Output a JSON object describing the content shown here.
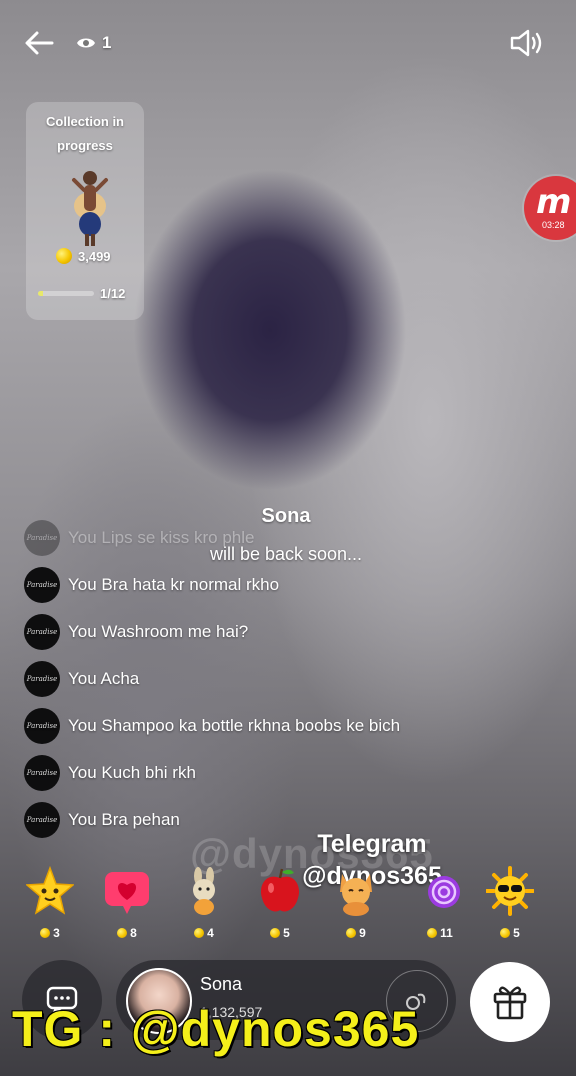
{
  "top_bar": {
    "back_icon": "arrow-left-icon",
    "viewer_icon": "eye-icon",
    "viewer_count": "1",
    "sound_icon": "speaker-icon"
  },
  "collection": {
    "title": "Collection in progress",
    "coin_value": "3,499",
    "progress_text": "1/12",
    "progress_fraction": 0.083
  },
  "recorder": {
    "logo": "m",
    "time": "03:28",
    "color": "#d9373e"
  },
  "host_message": {
    "name": "Sona",
    "status": "will be back soon..."
  },
  "chat": {
    "messages": [
      {
        "sender": "You",
        "text": "Lips se kiss kro phle",
        "avatar_text": "Paradise",
        "faded": true
      },
      {
        "sender": "You",
        "text": "Bra hata kr normal rkho",
        "avatar_text": "Paradise",
        "faded": false
      },
      {
        "sender": "You",
        "text": "Washroom me hai?",
        "avatar_text": "Paradise",
        "faded": false
      },
      {
        "sender": "You",
        "text": "Acha",
        "avatar_text": "Paradise",
        "faded": false
      },
      {
        "sender": "You",
        "text": "Shampoo ka bottle rkhna boobs ke bich",
        "avatar_text": "Paradise",
        "faded": false
      },
      {
        "sender": "You",
        "text": "Kuch bhi rkh",
        "avatar_text": "Paradise",
        "faded": false
      },
      {
        "sender": "You",
        "text": "Bra pehan",
        "avatar_text": "Paradise",
        "faded": false
      }
    ]
  },
  "watermark": {
    "faint": "@dynos365",
    "line1": "Telegram",
    "line2": "@dynos365",
    "banner": "TG : @dynos365"
  },
  "gifts": [
    {
      "icon": "star-icon",
      "price": "3"
    },
    {
      "icon": "heart-icon",
      "price": "8"
    },
    {
      "icon": "bunny-icon",
      "price": "4"
    },
    {
      "icon": "apple-icon",
      "price": "5"
    },
    {
      "icon": "cat-icon",
      "price": "9"
    },
    {
      "icon": "lollipop-icon",
      "price": "11"
    },
    {
      "icon": "sun-icon",
      "price": "5"
    }
  ],
  "bottom_bar": {
    "chat_icon": "chat-bubble-icon",
    "host_name": "Sona",
    "host_count": "1,132,597",
    "action_icon": "swirl-icon",
    "gift_icon": "gift-icon"
  },
  "colors": {
    "accent_yellow": "#f4ef1a",
    "coin": "#f5c600",
    "progress": "#e7e86a"
  }
}
